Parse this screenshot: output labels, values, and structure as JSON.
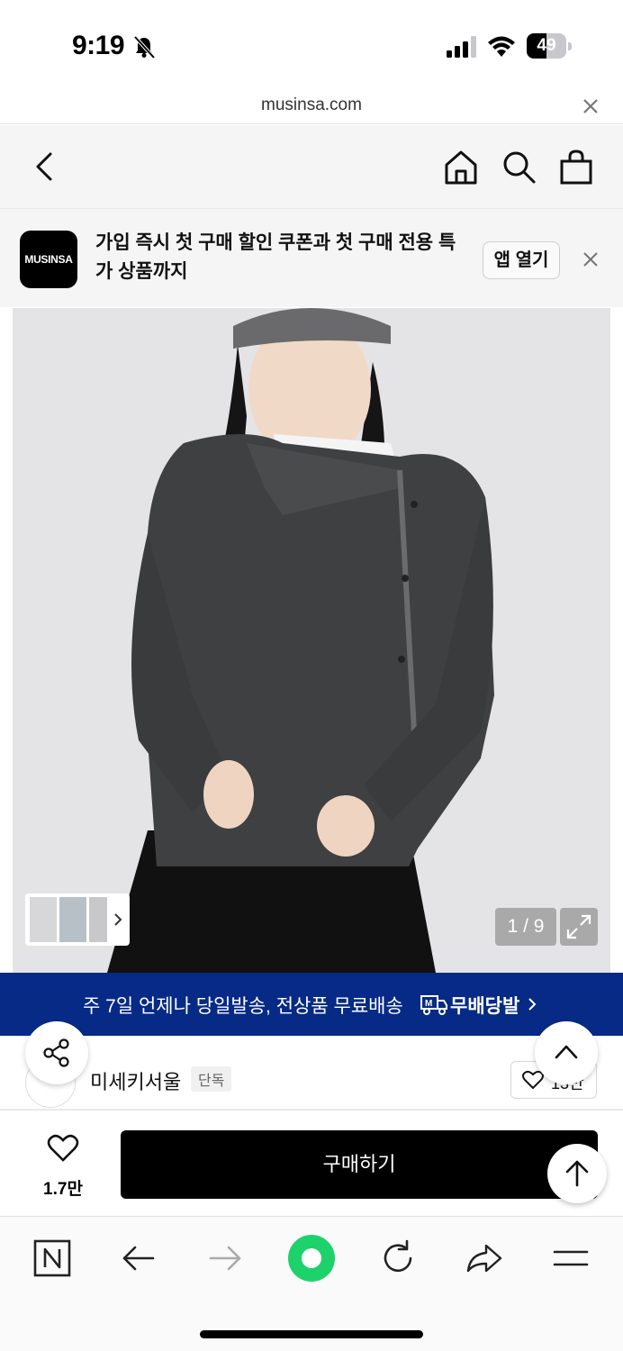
{
  "status": {
    "time": "9:19",
    "battery_level": "49",
    "battery_fraction": 0.49
  },
  "browser": {
    "url": "musinsa.com"
  },
  "header": {
    "icons": [
      "back-icon",
      "home-icon",
      "search-icon",
      "cart-icon"
    ]
  },
  "app_banner": {
    "logo_text": "MUSINSA",
    "message": "가입 즉시 첫 구매 할인 쿠폰과 첫 구매 전용 특가 상품까지",
    "open_app_label": "앱 열기"
  },
  "gallery": {
    "counter": "1 / 9"
  },
  "shipping": {
    "text": "주 7일 언제나 당일발송, 전상품 무료배송",
    "logo": "무배당발"
  },
  "brand": {
    "name": "미세키서울",
    "tag": "단독",
    "likes": "13만"
  },
  "purchase": {
    "like_count": "1.7만",
    "buy_label": "구매하기"
  },
  "colors": {
    "shipping_banner": "#062a86",
    "buy_button": "#000000",
    "browser_home": "#1ed26b"
  }
}
